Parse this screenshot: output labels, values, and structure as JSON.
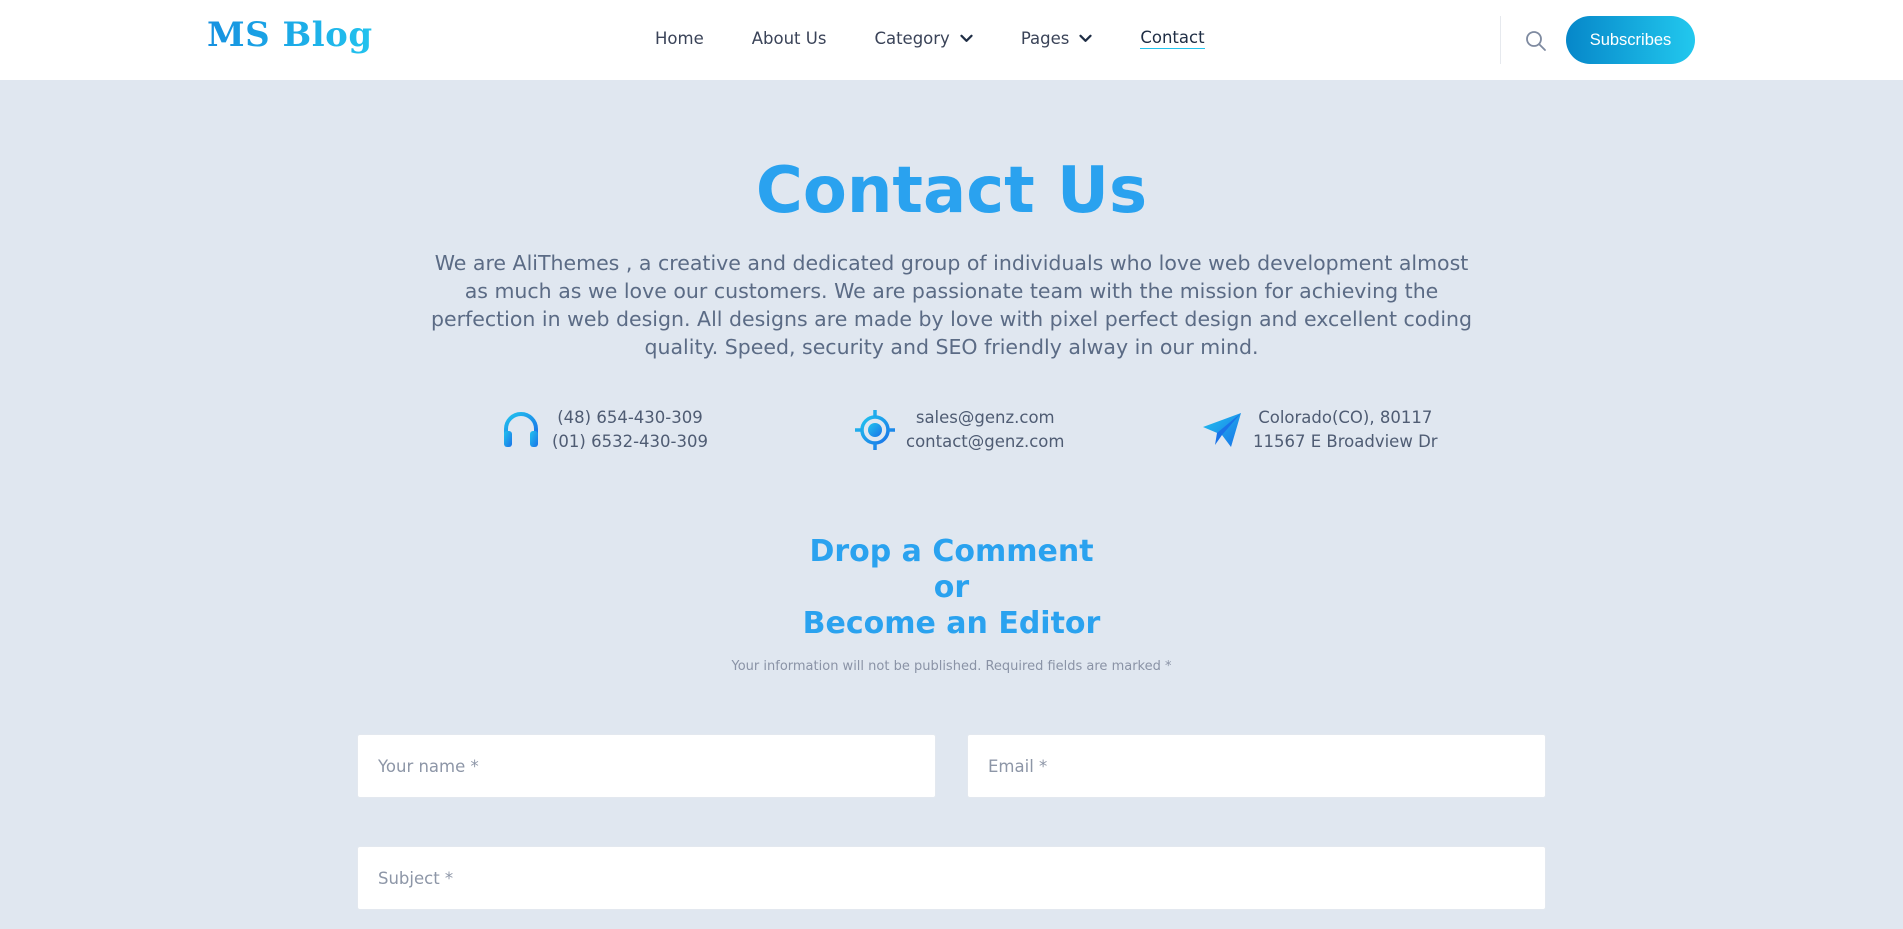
{
  "header": {
    "logo": "MS Blog",
    "nav": {
      "home": "Home",
      "about": "About Us",
      "category": "Category",
      "pages": "Pages",
      "contact": "Contact"
    },
    "subscribe_label": "Subscribes"
  },
  "hero": {
    "title": "Contact Us",
    "intro": "We are AliThemes , a creative and dedicated group of individuals who love web development almost as much as we love our customers. We are passionate team with the mission for achieving the perfection in web design. All designs are made by love with pixel perfect design and excellent coding quality. Speed, security and SEO friendly alway in our mind."
  },
  "contact_info": {
    "phone": {
      "icon": "headphones-icon",
      "line1": "(48) 654-430-309",
      "line2": "(01) 6532-430-309"
    },
    "email": {
      "icon": "target-icon",
      "line1": "sales@genz.com",
      "line2": "contact@genz.com"
    },
    "address": {
      "icon": "paper-plane-icon",
      "line1": "Colorado(CO), 80117",
      "line2": "11567 E Broadview Dr"
    }
  },
  "form": {
    "title_line1": "Drop a Comment",
    "title_line2": "or",
    "title_line3": "Become an Editor",
    "note": "Your information will not be published. Required fields are marked *",
    "name_placeholder": "Your name *",
    "email_placeholder": "Email *",
    "subject_placeholder": "Subject *"
  },
  "colors": {
    "accent": "#2aa2ef",
    "accent_light": "#22c3ee",
    "page_bg": "#e0e7f0",
    "header_bg": "#ffffff",
    "text": "#55627a"
  }
}
